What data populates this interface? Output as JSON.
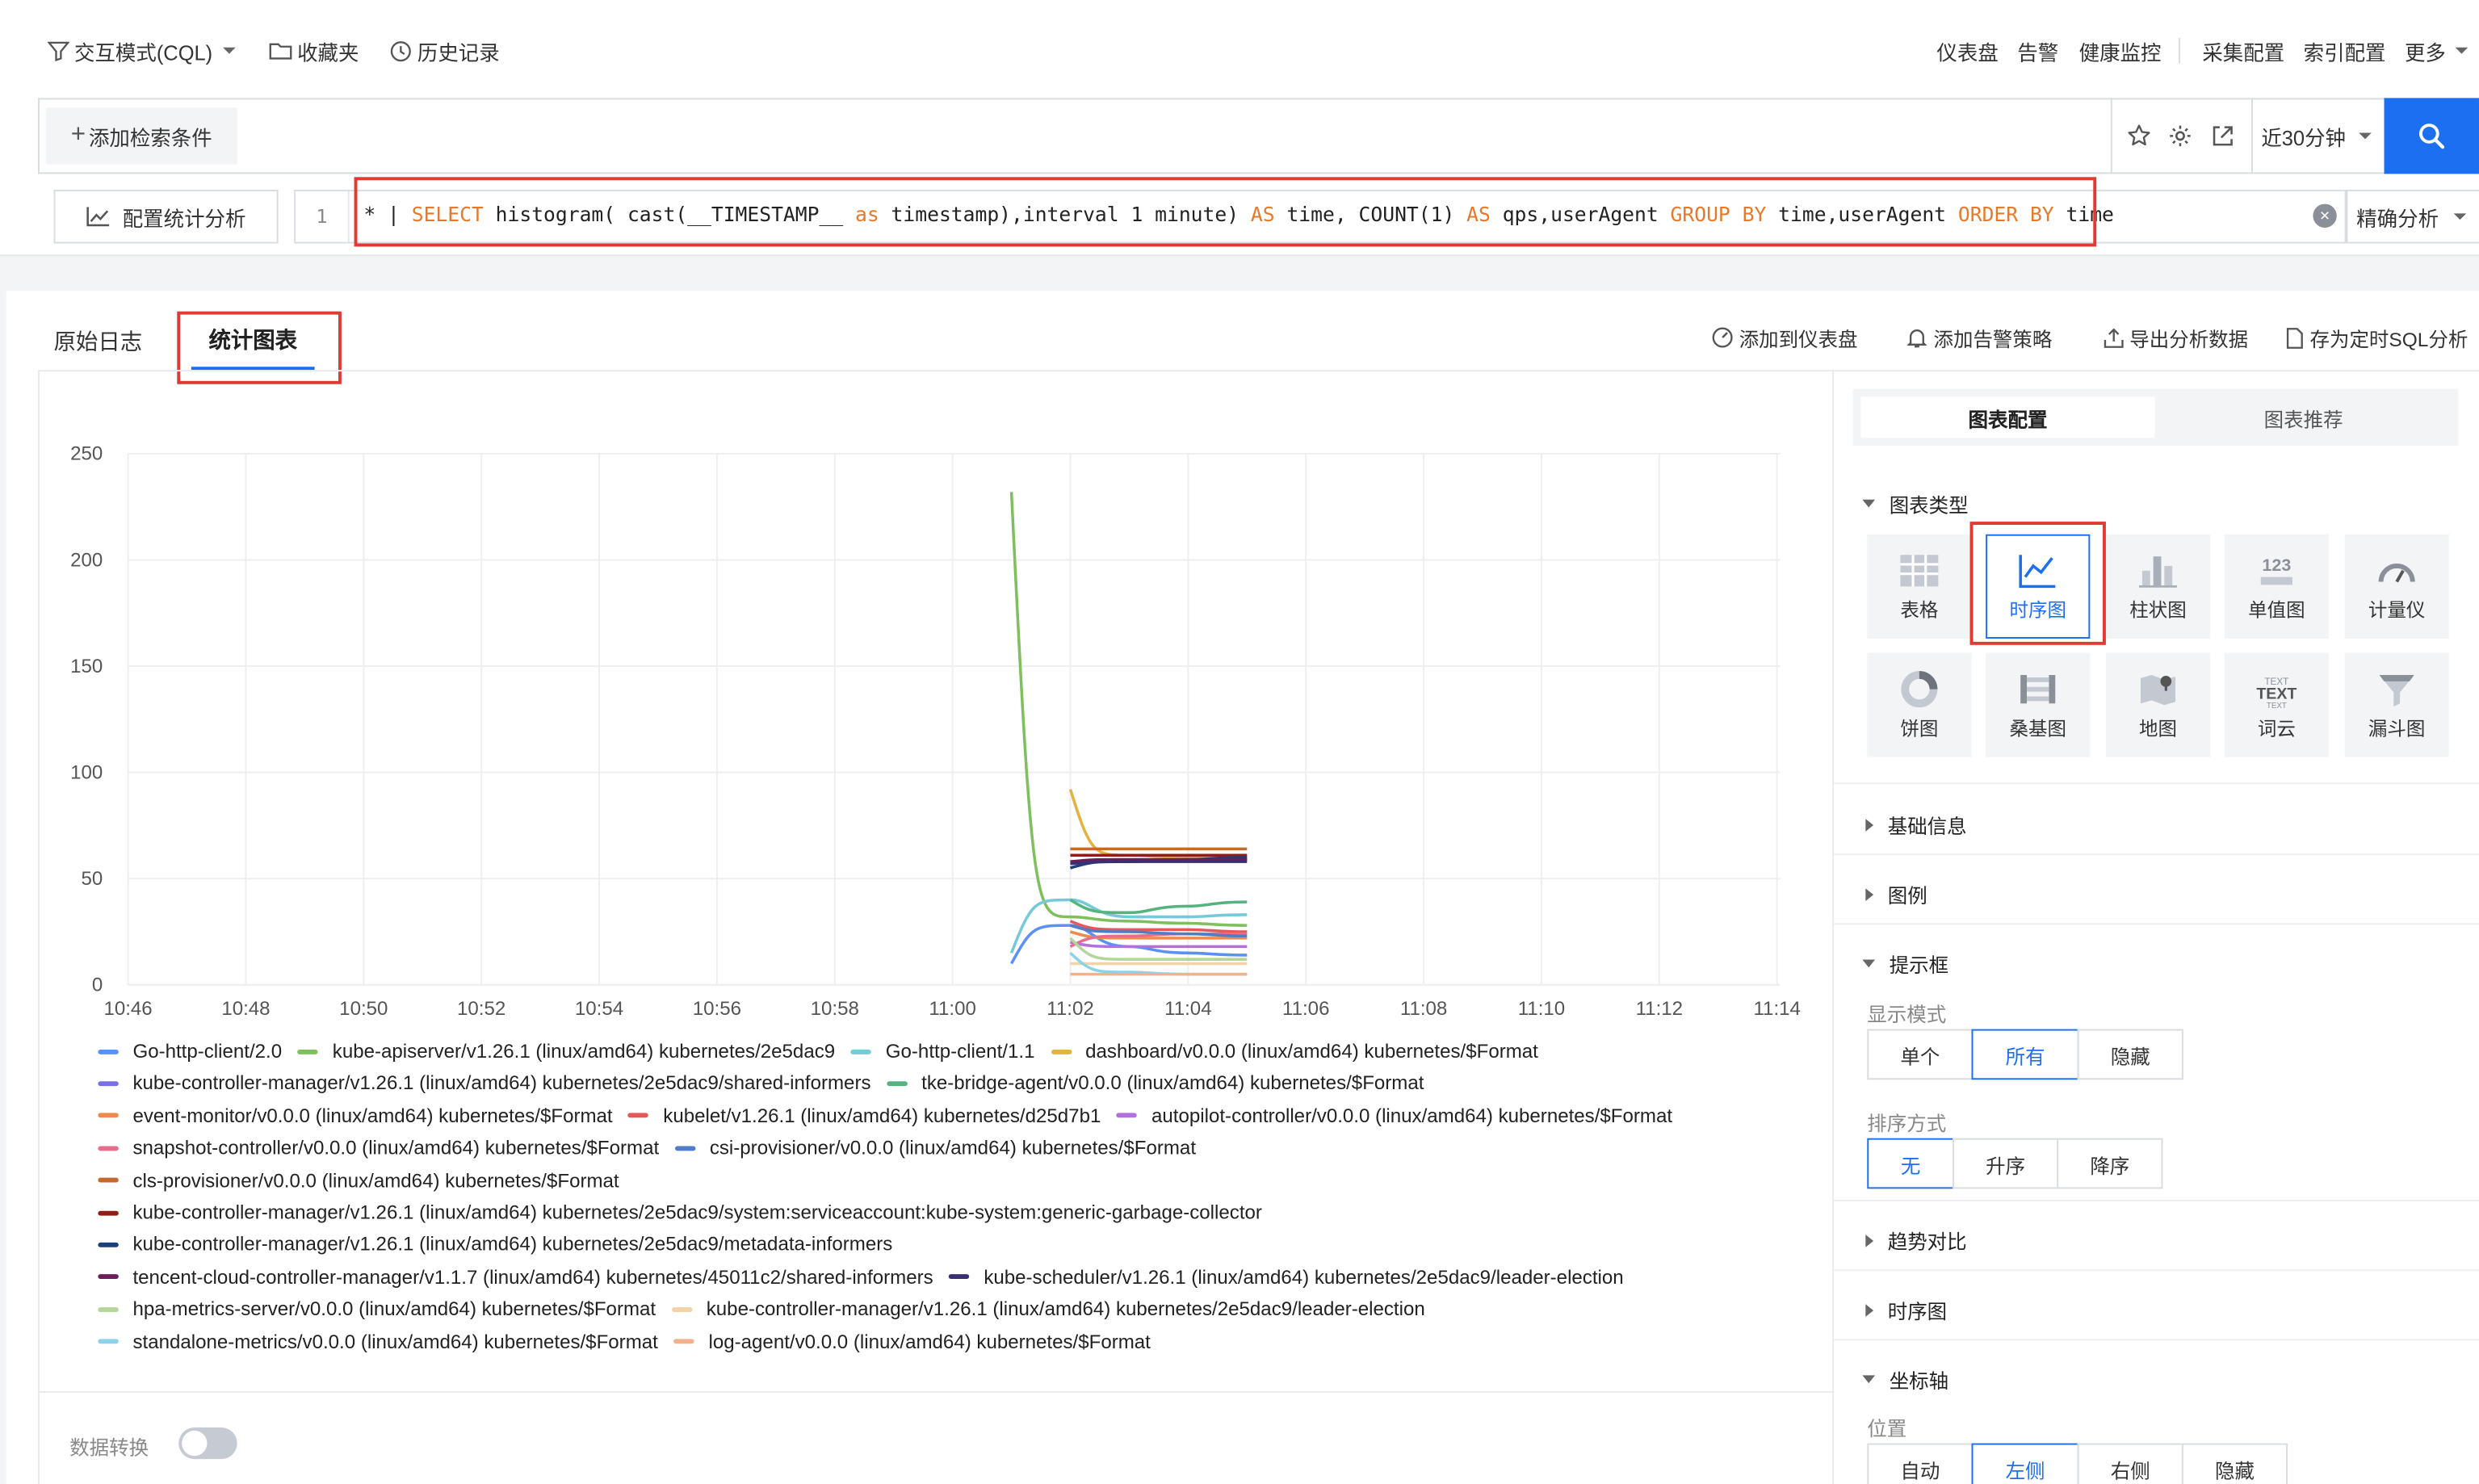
{
  "topnav": {
    "mode_label": "交互模式(CQL)",
    "favorites_label": "收藏夹",
    "history_label": "历史记录",
    "right_links": [
      "仪表盘",
      "告警",
      "健康监控",
      "采集配置",
      "索引配置",
      "更多"
    ]
  },
  "search": {
    "add_condition_label": "添加检索条件",
    "time_range": "近30分钟",
    "config_stats_label": "配置统计分析",
    "line_number": "1",
    "precision_label": "精确分析",
    "sql_tokens": [
      {
        "t": "* | ",
        "k": false
      },
      {
        "t": "SELECT",
        "k": true
      },
      {
        "t": " histogram( cast(__TIMESTAMP__ ",
        "k": false
      },
      {
        "t": "as",
        "k": true
      },
      {
        "t": " timestamp),interval 1 minute) ",
        "k": false
      },
      {
        "t": "AS",
        "k": true
      },
      {
        "t": " time, COUNT(1) ",
        "k": false
      },
      {
        "t": "AS",
        "k": true
      },
      {
        "t": " qps,userAgent ",
        "k": false
      },
      {
        "t": "GROUP BY",
        "k": true
      },
      {
        "t": " time,userAgent ",
        "k": false
      },
      {
        "t": "ORDER BY",
        "k": true
      },
      {
        "t": " time",
        "k": false
      }
    ]
  },
  "tabs": {
    "raw_logs": "原始日志",
    "stats_chart": "统计图表"
  },
  "actions": {
    "add_dashboard": "添加到仪表盘",
    "add_alarm": "添加告警策略",
    "export": "导出分析数据",
    "save_sql": "存为定时SQL分析"
  },
  "data_transform_label": "数据转换",
  "chart_data": {
    "type": "line",
    "ylim": [
      0,
      250
    ],
    "y_ticks": [
      "250",
      "200",
      "150",
      "100",
      "50",
      "0"
    ],
    "x_ticks": [
      "10:46",
      "10:48",
      "10:50",
      "10:52",
      "10:54",
      "10:56",
      "10:58",
      "11:00",
      "11:02",
      "11:04",
      "11:06",
      "11:08",
      "11:10",
      "11:12",
      "11:14"
    ],
    "x_unit": "minute",
    "series": [
      {
        "name": "Go-http-client/2.0",
        "color": "#5b8ff9",
        "x": [
          "11:01",
          "11:02",
          "11:03",
          "11:04",
          "11:05"
        ],
        "values": [
          10,
          28,
          18,
          15,
          14
        ]
      },
      {
        "name": "kube-apiserver/v1.26.1 (linux/amd64) kubernetes/2e5dac9",
        "color": "#7fbf5e",
        "x": [
          "11:01",
          "11:02",
          "11:03",
          "11:04",
          "11:05"
        ],
        "values": [
          232,
          32,
          30,
          29,
          28
        ]
      },
      {
        "name": "Go-http-client/1.1",
        "color": "#75c9d9",
        "x": [
          "11:01",
          "11:02",
          "11:03",
          "11:04",
          "11:05"
        ],
        "values": [
          15,
          40,
          32,
          32,
          33
        ]
      },
      {
        "name": "dashboard/v0.0.0 (linux/amd64) kubernetes/$Format",
        "color": "#e3b340",
        "x": [
          "11:02",
          "11:03",
          "11:04",
          "11:05"
        ],
        "values": [
          92,
          61,
          60,
          60
        ]
      },
      {
        "name": "kube-controller-manager/v1.26.1 (linux/amd64) kubernetes/2e5dac9/shared-informers",
        "color": "#7a6ee8",
        "x": [
          "11:02",
          "11:03",
          "11:04",
          "11:05"
        ],
        "values": [
          58,
          58,
          59,
          59
        ]
      },
      {
        "name": "tke-bridge-agent/v0.0.0 (linux/amd64) kubernetes/$Format",
        "color": "#56b37f",
        "x": [
          "11:02",
          "11:03",
          "11:04",
          "11:05"
        ],
        "values": [
          40,
          34,
          37,
          39
        ]
      },
      {
        "name": "event-monitor/v0.0.0 (linux/amd64) kubernetes/$Format",
        "color": "#ef8a4c",
        "x": [
          "11:02",
          "11:03",
          "11:04",
          "11:05"
        ],
        "values": [
          25,
          22,
          22,
          22
        ]
      },
      {
        "name": "kubelet/v1.26.1 (linux/amd64) kubernetes/d25d7b1",
        "color": "#e6575a",
        "x": [
          "11:02",
          "11:03",
          "11:04",
          "11:05"
        ],
        "values": [
          30,
          26,
          26,
          25
        ]
      },
      {
        "name": "autopilot-controller/v0.0.0 (linux/amd64) kubernetes/$Format",
        "color": "#b36ee0",
        "x": [
          "11:02",
          "11:03",
          "11:04",
          "11:05"
        ],
        "values": [
          20,
          18,
          18,
          18
        ]
      },
      {
        "name": "snapshot-controller/v0.0.0 (linux/amd64) kubernetes/$Format",
        "color": "#e86c8c",
        "x": [
          "11:02",
          "11:03",
          "11:04",
          "11:05"
        ],
        "values": [
          18,
          23,
          24,
          24
        ]
      },
      {
        "name": "csi-provisioner/v0.0.0 (linux/amd64) kubernetes/$Format",
        "color": "#4f7dc9",
        "x": [
          "11:02",
          "11:03",
          "11:04",
          "11:05"
        ],
        "values": [
          28,
          25,
          24,
          23
        ]
      },
      {
        "name": "cls-provisioner/v0.0.0 (linux/amd64) kubernetes/$Format",
        "color": "#c56a2f",
        "x": [
          "11:02",
          "11:03",
          "11:04",
          "11:05"
        ],
        "values": [
          64,
          64,
          64,
          64
        ]
      },
      {
        "name": "kube-controller-manager/v1.26.1 (linux/amd64) kubernetes/2e5dac9/system:serviceaccount:kube-system:generic-garbage-collector",
        "color": "#8f1f16",
        "x": [
          "11:02",
          "11:03",
          "11:04",
          "11:05"
        ],
        "values": [
          61,
          61,
          61,
          61
        ]
      },
      {
        "name": "kube-controller-manager/v1.26.1 (linux/amd64) kubernetes/2e5dac9/metadata-informers",
        "color": "#1e3f7a",
        "x": [
          "11:02",
          "11:03",
          "11:04",
          "11:05"
        ],
        "values": [
          55,
          58,
          59,
          60
        ]
      },
      {
        "name": "tencent-cloud-controller-manager/v1.1.7 (linux/amd64) kubernetes/45011c2/shared-informers",
        "color": "#6b1e57",
        "x": [
          "11:02",
          "11:03",
          "11:04",
          "11:05"
        ],
        "values": [
          58,
          59,
          59,
          59
        ]
      },
      {
        "name": "kube-scheduler/v1.26.1 (linux/amd64) kubernetes/2e5dac9/leader-election",
        "color": "#3a2f73",
        "x": [
          "11:02",
          "11:03",
          "11:04",
          "11:05"
        ],
        "values": [
          57,
          58,
          58,
          58
        ]
      },
      {
        "name": "hpa-metrics-server/v0.0.0 (linux/amd64) kubernetes/$Format",
        "color": "#b4d69a",
        "x": [
          "11:02",
          "11:03",
          "11:04",
          "11:05"
        ],
        "values": [
          22,
          12,
          12,
          12
        ]
      },
      {
        "name": "kube-controller-manager/v1.26.1 (linux/amd64) kubernetes/2e5dac9/leader-election",
        "color": "#f2d3a8",
        "x": [
          "11:02",
          "11:03",
          "11:04",
          "11:05"
        ],
        "values": [
          10,
          10,
          10,
          10
        ]
      },
      {
        "name": "standalone-metrics/v0.0.0 (linux/amd64) kubernetes/$Format",
        "color": "#8bd3ea",
        "x": [
          "11:02",
          "11:03",
          "11:04",
          "11:05"
        ],
        "values": [
          15,
          6,
          5,
          5
        ]
      },
      {
        "name": "log-agent/v0.0.0 (linux/amd64) kubernetes/$Format",
        "color": "#f2b08b",
        "x": [
          "11:02",
          "11:03",
          "11:04",
          "11:05"
        ],
        "values": [
          5,
          5,
          5,
          5
        ]
      }
    ],
    "legend_rows": [
      [
        0,
        1,
        2,
        3
      ],
      [
        4,
        5
      ],
      [
        6,
        7,
        8
      ],
      [
        9,
        10
      ],
      [
        11
      ],
      [
        12
      ],
      [
        13
      ],
      [
        14,
        15
      ],
      [
        16,
        17
      ],
      [
        18,
        19
      ]
    ],
    "grid": true,
    "legend_position": "bottom"
  },
  "sidebar": {
    "tab_config": "图表配置",
    "tab_recommend": "图表推荐",
    "chart_type_title": "图表类型",
    "chart_types": [
      {
        "label": "表格",
        "icon": "table-icon",
        "selected": false
      },
      {
        "label": "时序图",
        "icon": "timeseries-icon",
        "selected": true
      },
      {
        "label": "柱状图",
        "icon": "bar-chart-icon",
        "selected": false
      },
      {
        "label": "单值图",
        "icon": "single-value-icon",
        "selected": false
      },
      {
        "label": "计量仪",
        "icon": "gauge-icon",
        "selected": false
      },
      {
        "label": "饼图",
        "icon": "pie-chart-icon",
        "selected": false
      },
      {
        "label": "桑基图",
        "icon": "sankey-icon",
        "selected": false
      },
      {
        "label": "地图",
        "icon": "map-icon",
        "selected": false
      },
      {
        "label": "词云",
        "icon": "word-cloud-icon",
        "selected": false
      },
      {
        "label": "漏斗图",
        "icon": "funnel-icon",
        "selected": false
      }
    ],
    "single_value_icon_text": "123",
    "word_cloud_icon_text": "TEXT",
    "basic_info": "基础信息",
    "legend": "图例",
    "tooltip": "提示框",
    "display_mode_label": "显示模式",
    "display_modes": [
      "单个",
      "所有",
      "隐藏"
    ],
    "display_mode_selected": "所有",
    "sort_label": "排序方式",
    "sort_options": [
      "无",
      "升序",
      "降序"
    ],
    "sort_selected": "无",
    "trend_compare": "趋势对比",
    "timeseries": "时序图",
    "axis": "坐标轴",
    "position_label": "位置",
    "position_options": [
      "自动",
      "左侧",
      "右侧",
      "隐藏"
    ],
    "position_selected": "左侧"
  }
}
